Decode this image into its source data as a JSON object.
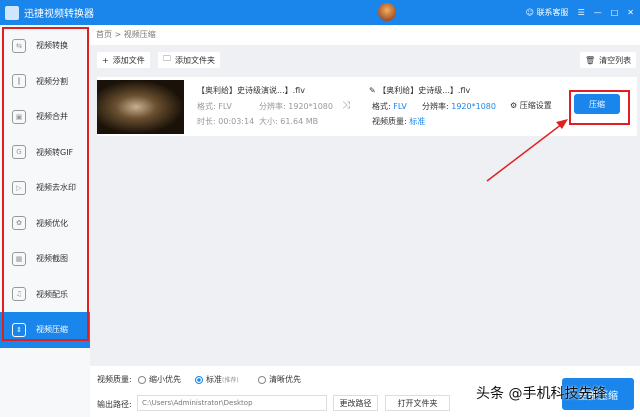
{
  "app": {
    "title": "迅捷视频转换器",
    "support": "联系客服",
    "menu_icon": "menu-icon",
    "min": "—",
    "max": "□",
    "close": "✕"
  },
  "sidebar": {
    "items": [
      {
        "label": "视频转换",
        "icon": "⇆"
      },
      {
        "label": "视频分割",
        "icon": "‖"
      },
      {
        "label": "视频合并",
        "icon": "▣"
      },
      {
        "label": "视频转GIF",
        "icon": "G"
      },
      {
        "label": "视频去水印",
        "icon": "▷"
      },
      {
        "label": "视频优化",
        "icon": "✿"
      },
      {
        "label": "视频截图",
        "icon": "▦"
      },
      {
        "label": "视频配乐",
        "icon": "♫"
      },
      {
        "label": "视频压缩",
        "icon": "⇕"
      }
    ]
  },
  "breadcrumb": {
    "home": "首页",
    "sep": ">",
    "current": "视频压缩"
  },
  "toolbar": {
    "add_file": "添加文件",
    "add_folder": "添加文件夹",
    "clear": "清空列表"
  },
  "item": {
    "src_name": "【奥利给】史诗级演说...】.flv",
    "src_format_label": "格式:",
    "src_format": "FLV",
    "src_res_label": "分辨率:",
    "src_res": "1920*1080",
    "duration_label": "时长:",
    "duration": "00:03:14",
    "size_label": "大小:",
    "size": "61.64 MB",
    "out_name": "【奥利给】史诗级...】.flv",
    "out_format_label": "格式:",
    "out_format": "FLV",
    "out_res_label": "分辨率:",
    "out_res": "1920*1080",
    "quality_label": "视频质量:",
    "quality": "标准",
    "settings": "压缩设置",
    "compress": "压缩"
  },
  "bottom": {
    "quality_label": "视频质量:",
    "opt1": "缩小优先",
    "opt2": "标准",
    "opt2_hint": "(推荐)",
    "opt3": "清晰优先",
    "path_label": "输出路径:",
    "path": "C:\\Users\\Administrator\\Desktop",
    "change_path": "更改路径",
    "open_folder": "打开文件夹",
    "compress_all": "全部压缩"
  },
  "watermark": "头条 @手机科技先锋"
}
